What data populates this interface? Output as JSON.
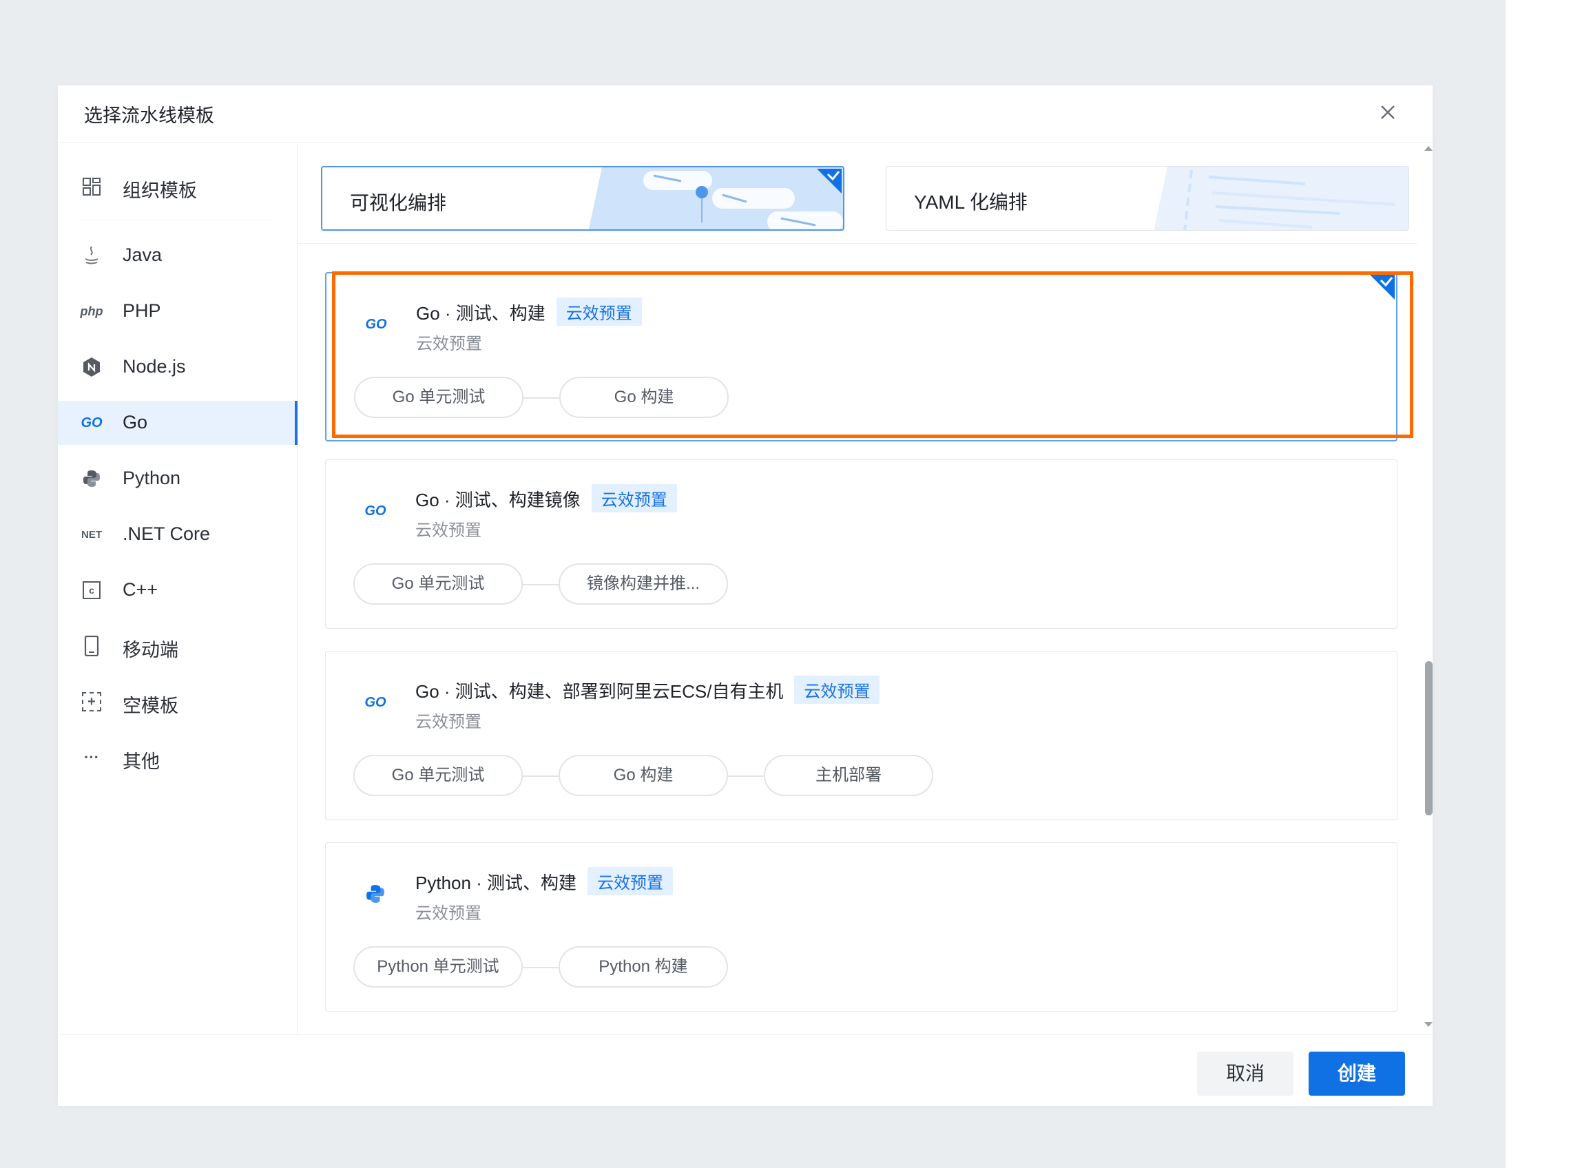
{
  "dialog": {
    "title": "选择流水线模板"
  },
  "sidebar": {
    "items": [
      {
        "label": "组织模板",
        "icon": "grid-icon"
      },
      {
        "label": "Java",
        "icon": "java-icon"
      },
      {
        "label": "PHP",
        "icon": "php-icon",
        "icon_text": "php"
      },
      {
        "label": "Node.js",
        "icon": "nodejs-icon"
      },
      {
        "label": "Go",
        "icon": "go-icon",
        "icon_text": "GO",
        "active": true
      },
      {
        "label": "Python",
        "icon": "python-icon"
      },
      {
        "label": ".NET Core",
        "icon": "dotnet-icon",
        "icon_text": "NET"
      },
      {
        "label": "C++",
        "icon": "cpp-icon",
        "icon_text": "c"
      },
      {
        "label": "移动端",
        "icon": "mobile-icon"
      },
      {
        "label": "空模板",
        "icon": "empty-template-icon",
        "icon_text": "+"
      },
      {
        "label": "其他",
        "icon": "more-icon",
        "icon_text": "···"
      }
    ]
  },
  "modes": [
    {
      "label": "可视化编排",
      "selected": true
    },
    {
      "label": "YAML 化编排",
      "selected": false
    }
  ],
  "templates": [
    {
      "title": "Go · 测试、构建",
      "badge": "云效预置",
      "subtitle": "云效预置",
      "icon": "go-icon",
      "icon_text": "GO",
      "selected": true,
      "stages": [
        "Go 单元测试",
        "Go 构建"
      ]
    },
    {
      "title": "Go · 测试、构建镜像",
      "badge": "云效预置",
      "subtitle": "云效预置",
      "icon": "go-icon",
      "icon_text": "GO",
      "selected": false,
      "stages": [
        "Go 单元测试",
        "镜像构建并推..."
      ]
    },
    {
      "title": "Go · 测试、构建、部署到阿里云ECS/自有主机",
      "badge": "云效预置",
      "subtitle": "云效预置",
      "icon": "go-icon",
      "icon_text": "GO",
      "selected": false,
      "stages": [
        "Go 单元测试",
        "Go 构建",
        "主机部署"
      ]
    },
    {
      "title": "Python · 测试、构建",
      "badge": "云效预置",
      "subtitle": "云效预置",
      "icon": "python-icon",
      "selected": false,
      "stages": [
        "Python 单元测试",
        "Python 构建"
      ]
    }
  ],
  "footer": {
    "cancel_label": "取消",
    "create_label": "创建"
  },
  "colors": {
    "accent": "#1071e5",
    "highlight_outline": "#ff6a00",
    "badge_bg": "#e3f0ff",
    "active_item_bg": "#e8f2ff"
  }
}
